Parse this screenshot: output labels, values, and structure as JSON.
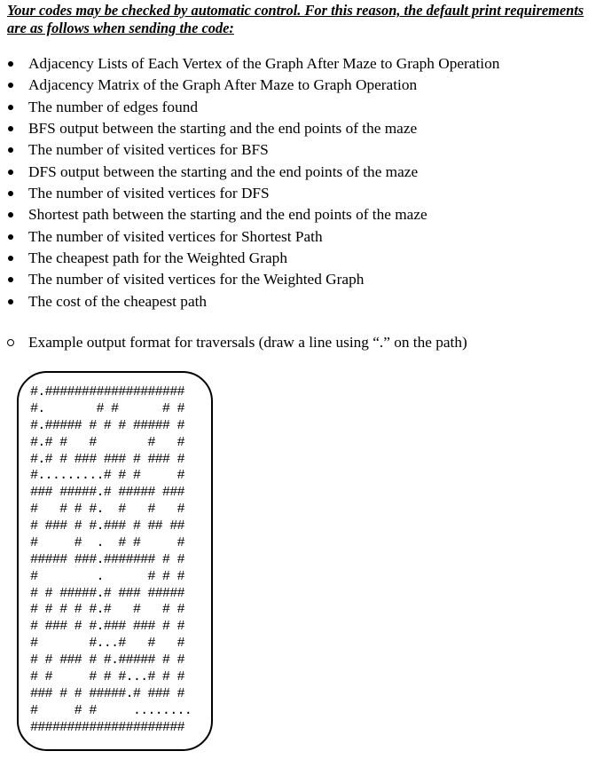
{
  "note": "Your codes may be checked by automatic control. For this reason, the default print requirements are as follows when sending the code:",
  "requirements": [
    "Adjacency Lists of Each Vertex of the Graph After Maze to Graph Operation",
    "Adjacency Matrix of the Graph After Maze to Graph Operation",
    "The number of edges found",
    "BFS output between the starting and the end points of the maze",
    "The number of visited vertices for BFS",
    "DFS output between the starting and the end points of the maze",
    "The number of visited vertices for DFS",
    "Shortest path between the starting and the end points of the maze",
    "The number of visited vertices for Shortest Path",
    "The cheapest path for the Weighted Graph",
    "The number of visited vertices for the Weighted Graph",
    "The cost of the cheapest path"
  ],
  "example_intro": "Example output format for traversals (draw a line using “.” on the path)",
  "maze_lines": [
    "#.###################",
    "#.       # #      # #",
    "#.##### # # # ##### #",
    "#.# #   #       #   #",
    "#.# # ### ### # ### #",
    "#.........# # #     #",
    "### #####.# ##### ###",
    "#   # # #.  #   #   #",
    "# ### # #.### # ## ##",
    "#     #  .  # #     #",
    "##### ###.####### # #",
    "#        .      # # #",
    "# # #####.# ### #####",
    "# # # # #.#   #   # #",
    "# ### # #.### ### # #",
    "#       #...#   #   #",
    "# # ### # #.##### # #",
    "# #     # # #...# # #",
    "### # # #####.# ### #",
    "#     # #     ........",
    "#####################"
  ]
}
